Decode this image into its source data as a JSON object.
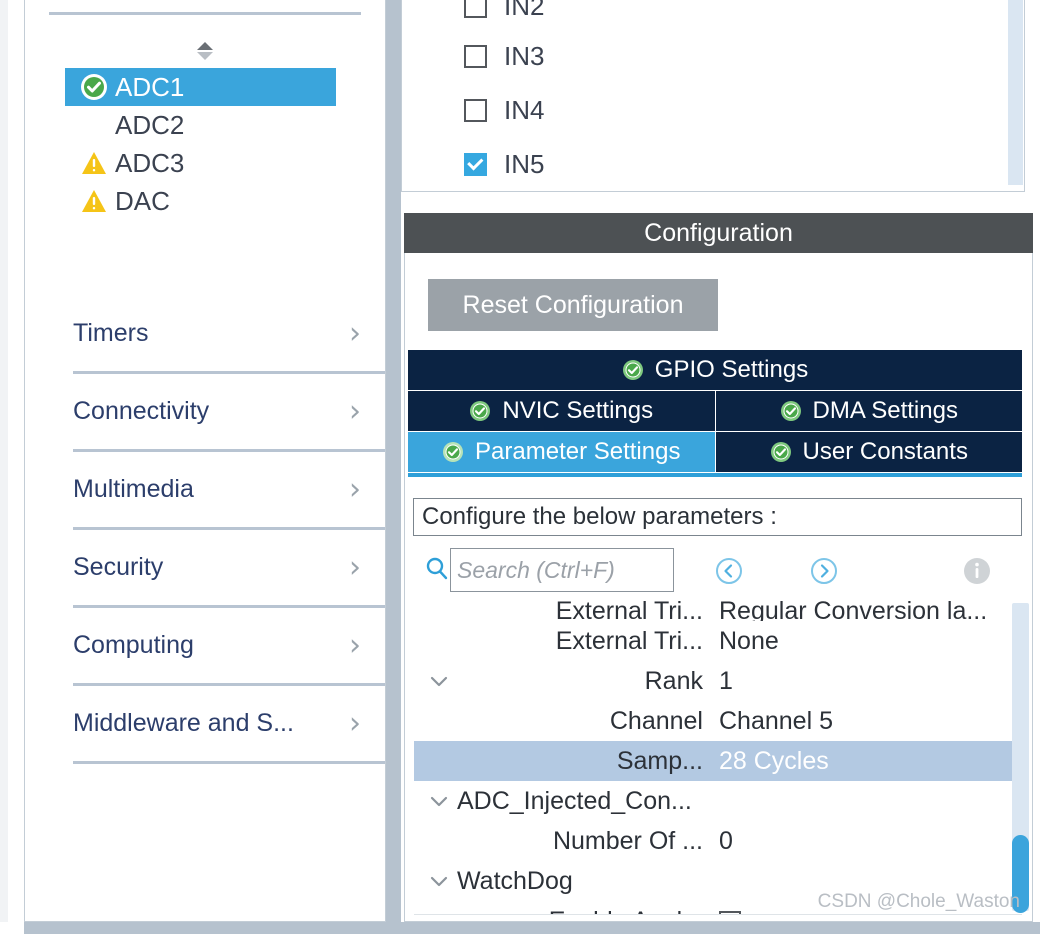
{
  "left_panel": {
    "tree_items": [
      {
        "label": "ADC1",
        "status": "ok",
        "selected": true
      },
      {
        "label": "ADC2",
        "status": "none",
        "selected": false
      },
      {
        "label": "ADC3",
        "status": "warning",
        "selected": false
      },
      {
        "label": "DAC",
        "status": "warning",
        "selected": false
      }
    ],
    "categories": [
      {
        "label": "Timers"
      },
      {
        "label": "Connectivity"
      },
      {
        "label": "Multimedia"
      },
      {
        "label": "Security"
      },
      {
        "label": "Computing"
      },
      {
        "label": "Middleware and S..."
      }
    ]
  },
  "input_panel": {
    "checkboxes": [
      {
        "label": "IN2",
        "checked": false
      },
      {
        "label": "IN3",
        "checked": false
      },
      {
        "label": "IN4",
        "checked": false
      },
      {
        "label": "IN5",
        "checked": true
      }
    ]
  },
  "configuration": {
    "title": "Configuration",
    "reset_label": "Reset Configuration",
    "tabs": [
      {
        "label": "GPIO Settings",
        "active": false
      },
      {
        "label": "NVIC Settings",
        "active": false
      },
      {
        "label": "DMA Settings",
        "active": false
      },
      {
        "label": "Parameter Settings",
        "active": true
      },
      {
        "label": "User Constants",
        "active": false
      }
    ],
    "configure_hint": "Configure the below parameters :",
    "search": {
      "placeholder": "Search (Ctrl+F)",
      "value": ""
    },
    "parameters": [
      {
        "label": "External Tri...",
        "value": "Regular Conversion la...",
        "twisty": "",
        "selected": false,
        "clipped": true,
        "indent": "right"
      },
      {
        "label": "External Tri...",
        "value": "None",
        "twisty": "",
        "selected": false,
        "clipped": false,
        "indent": "right"
      },
      {
        "label": "Rank",
        "value": "1",
        "twisty": "down",
        "selected": false,
        "clipped": false,
        "indent": "right"
      },
      {
        "label": "Channel",
        "value": "Channel 5",
        "twisty": "",
        "selected": false,
        "clipped": false,
        "indent": "right"
      },
      {
        "label": "Samp...",
        "value": "28 Cycles",
        "twisty": "",
        "selected": true,
        "clipped": false,
        "indent": "right"
      },
      {
        "label": "ADC_Injected_Con...",
        "value": "",
        "twisty": "down",
        "selected": false,
        "clipped": false,
        "indent": "left"
      },
      {
        "label": "Number Of ...",
        "value": "0",
        "twisty": "",
        "selected": false,
        "clipped": false,
        "indent": "right"
      },
      {
        "label": "WatchDog",
        "value": "",
        "twisty": "down",
        "selected": false,
        "clipped": false,
        "indent": "left"
      },
      {
        "label": "Enable Anal...",
        "value": "checkbox",
        "twisty": "",
        "selected": false,
        "clipped": false,
        "indent": "right"
      }
    ]
  },
  "watermark": "CSDN @Chole_Waston",
  "colors": {
    "selection_blue": "#3aa5dc",
    "tab_navy": "#0b2343",
    "config_header_gray": "#4d5154",
    "reset_button_gray": "#9ba2a8",
    "row_selected_blue": "#b3c9e2",
    "warning_yellow": "#f5c417",
    "ok_green": "#4aa84a",
    "splitter_gray": "#b6c2ce",
    "scrollbar_thumb": "#3ba4dc",
    "scrollbar_track": "#dae6f2",
    "category_text": "#2c3e6b"
  }
}
